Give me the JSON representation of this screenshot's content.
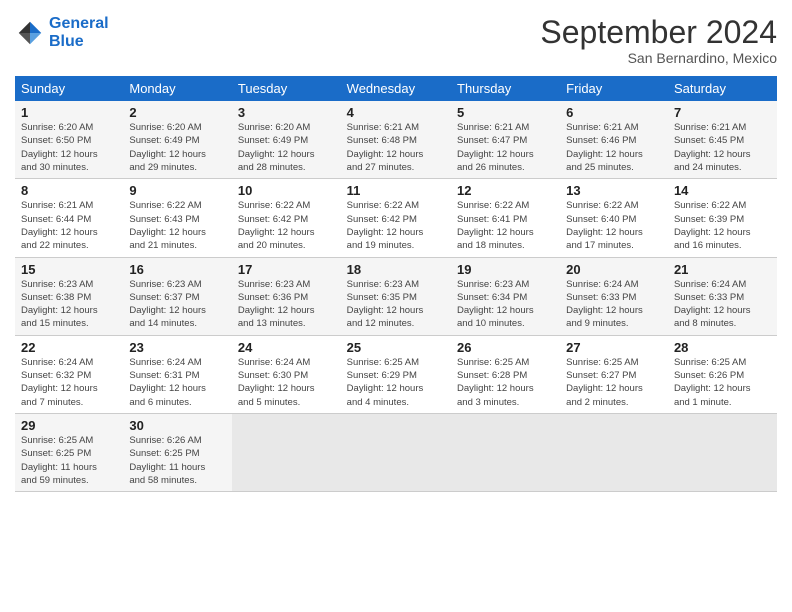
{
  "header": {
    "logo_line1": "General",
    "logo_line2": "Blue",
    "month": "September 2024",
    "location": "San Bernardino, Mexico"
  },
  "days_of_week": [
    "Sunday",
    "Monday",
    "Tuesday",
    "Wednesday",
    "Thursday",
    "Friday",
    "Saturday"
  ],
  "weeks": [
    [
      {
        "num": "1",
        "info": "Sunrise: 6:20 AM\nSunset: 6:50 PM\nDaylight: 12 hours\nand 30 minutes."
      },
      {
        "num": "2",
        "info": "Sunrise: 6:20 AM\nSunset: 6:49 PM\nDaylight: 12 hours\nand 29 minutes."
      },
      {
        "num": "3",
        "info": "Sunrise: 6:20 AM\nSunset: 6:49 PM\nDaylight: 12 hours\nand 28 minutes."
      },
      {
        "num": "4",
        "info": "Sunrise: 6:21 AM\nSunset: 6:48 PM\nDaylight: 12 hours\nand 27 minutes."
      },
      {
        "num": "5",
        "info": "Sunrise: 6:21 AM\nSunset: 6:47 PM\nDaylight: 12 hours\nand 26 minutes."
      },
      {
        "num": "6",
        "info": "Sunrise: 6:21 AM\nSunset: 6:46 PM\nDaylight: 12 hours\nand 25 minutes."
      },
      {
        "num": "7",
        "info": "Sunrise: 6:21 AM\nSunset: 6:45 PM\nDaylight: 12 hours\nand 24 minutes."
      }
    ],
    [
      {
        "num": "8",
        "info": "Sunrise: 6:21 AM\nSunset: 6:44 PM\nDaylight: 12 hours\nand 22 minutes."
      },
      {
        "num": "9",
        "info": "Sunrise: 6:22 AM\nSunset: 6:43 PM\nDaylight: 12 hours\nand 21 minutes."
      },
      {
        "num": "10",
        "info": "Sunrise: 6:22 AM\nSunset: 6:42 PM\nDaylight: 12 hours\nand 20 minutes."
      },
      {
        "num": "11",
        "info": "Sunrise: 6:22 AM\nSunset: 6:42 PM\nDaylight: 12 hours\nand 19 minutes."
      },
      {
        "num": "12",
        "info": "Sunrise: 6:22 AM\nSunset: 6:41 PM\nDaylight: 12 hours\nand 18 minutes."
      },
      {
        "num": "13",
        "info": "Sunrise: 6:22 AM\nSunset: 6:40 PM\nDaylight: 12 hours\nand 17 minutes."
      },
      {
        "num": "14",
        "info": "Sunrise: 6:22 AM\nSunset: 6:39 PM\nDaylight: 12 hours\nand 16 minutes."
      }
    ],
    [
      {
        "num": "15",
        "info": "Sunrise: 6:23 AM\nSunset: 6:38 PM\nDaylight: 12 hours\nand 15 minutes."
      },
      {
        "num": "16",
        "info": "Sunrise: 6:23 AM\nSunset: 6:37 PM\nDaylight: 12 hours\nand 14 minutes."
      },
      {
        "num": "17",
        "info": "Sunrise: 6:23 AM\nSunset: 6:36 PM\nDaylight: 12 hours\nand 13 minutes."
      },
      {
        "num": "18",
        "info": "Sunrise: 6:23 AM\nSunset: 6:35 PM\nDaylight: 12 hours\nand 12 minutes."
      },
      {
        "num": "19",
        "info": "Sunrise: 6:23 AM\nSunset: 6:34 PM\nDaylight: 12 hours\nand 10 minutes."
      },
      {
        "num": "20",
        "info": "Sunrise: 6:24 AM\nSunset: 6:33 PM\nDaylight: 12 hours\nand 9 minutes."
      },
      {
        "num": "21",
        "info": "Sunrise: 6:24 AM\nSunset: 6:33 PM\nDaylight: 12 hours\nand 8 minutes."
      }
    ],
    [
      {
        "num": "22",
        "info": "Sunrise: 6:24 AM\nSunset: 6:32 PM\nDaylight: 12 hours\nand 7 minutes."
      },
      {
        "num": "23",
        "info": "Sunrise: 6:24 AM\nSunset: 6:31 PM\nDaylight: 12 hours\nand 6 minutes."
      },
      {
        "num": "24",
        "info": "Sunrise: 6:24 AM\nSunset: 6:30 PM\nDaylight: 12 hours\nand 5 minutes."
      },
      {
        "num": "25",
        "info": "Sunrise: 6:25 AM\nSunset: 6:29 PM\nDaylight: 12 hours\nand 4 minutes."
      },
      {
        "num": "26",
        "info": "Sunrise: 6:25 AM\nSunset: 6:28 PM\nDaylight: 12 hours\nand 3 minutes."
      },
      {
        "num": "27",
        "info": "Sunrise: 6:25 AM\nSunset: 6:27 PM\nDaylight: 12 hours\nand 2 minutes."
      },
      {
        "num": "28",
        "info": "Sunrise: 6:25 AM\nSunset: 6:26 PM\nDaylight: 12 hours\nand 1 minute."
      }
    ],
    [
      {
        "num": "29",
        "info": "Sunrise: 6:25 AM\nSunset: 6:25 PM\nDaylight: 11 hours\nand 59 minutes."
      },
      {
        "num": "30",
        "info": "Sunrise: 6:26 AM\nSunset: 6:25 PM\nDaylight: 11 hours\nand 58 minutes."
      },
      null,
      null,
      null,
      null,
      null
    ]
  ]
}
